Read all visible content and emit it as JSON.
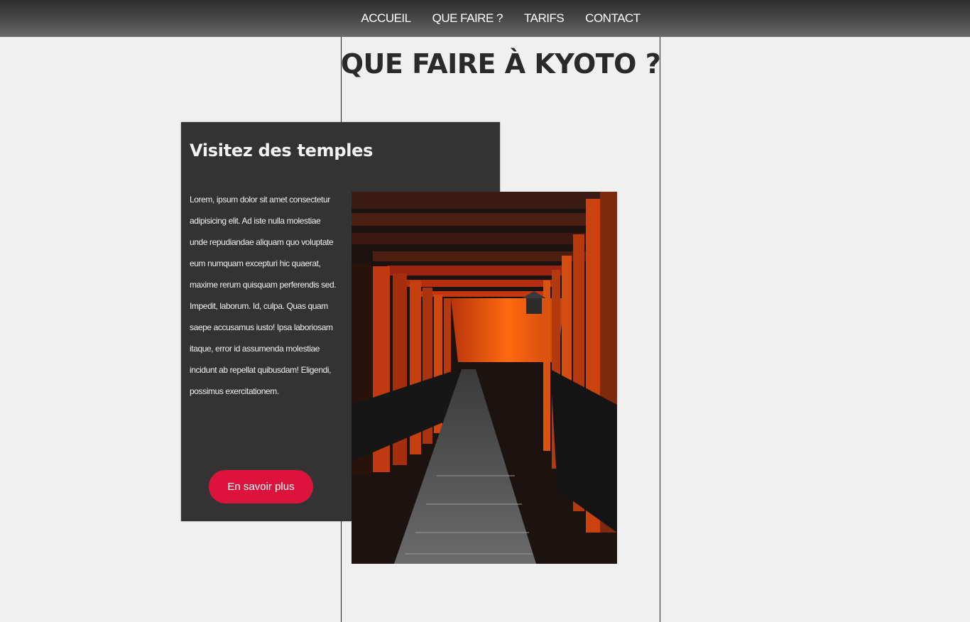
{
  "nav": {
    "items": [
      {
        "label": "ACCUEIL"
      },
      {
        "label": "QUE FAIRE ?"
      },
      {
        "label": "TARIFS"
      },
      {
        "label": "CONTACT"
      }
    ]
  },
  "page": {
    "title": "QUE FAIRE À KYOTO ?"
  },
  "card": {
    "title": "Visitez des temples",
    "text": "Lorem, ipsum dolor sit amet consectetur adipisicing elit. Ad iste nulla molestiae unde repudiandae aliquam quo voluptate eum numquam excepturi hic quaerat, maxime rerum quisquam perferendis sed. Impedit, laborum. Id, culpa. Quas quam saepe accusamus iusto! Ipsa laboriosam itaque, error id assumenda molestiae incidunt ab repellat quibusdam! Eligendi, possimus exercitationem.",
    "button_label": "En savoir plus",
    "image_label": "fushimi-inari-torii-gates-photo"
  },
  "colors": {
    "nav_bg": "#3d3d3d",
    "card_bg": "#333333",
    "accent": "#dc143c",
    "page_bg": "#f0f0f0"
  }
}
